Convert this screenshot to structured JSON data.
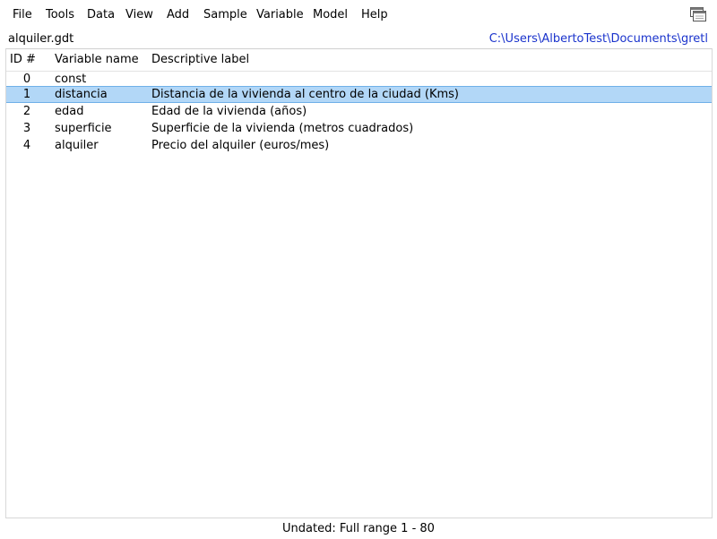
{
  "menu": [
    {
      "label": "File",
      "name": "menu-file"
    },
    {
      "label": "Tools",
      "name": "menu-tools"
    },
    {
      "label": "Data",
      "name": "menu-data"
    },
    {
      "label": "View",
      "name": "menu-view"
    },
    {
      "label": "Add",
      "name": "menu-add"
    },
    {
      "label": "Sample",
      "name": "menu-sample"
    },
    {
      "label": "Variable",
      "name": "menu-variable"
    },
    {
      "label": "Model",
      "name": "menu-model"
    },
    {
      "label": "Help",
      "name": "menu-help"
    }
  ],
  "window_icon": "window-switch-icon",
  "infobar": {
    "filename": "alquiler.gdt",
    "path": "C:\\Users\\AlbertoTest\\Documents\\gretl"
  },
  "table": {
    "headers": {
      "id": "ID #",
      "name": "Variable name",
      "label": "Descriptive label"
    },
    "rows": [
      {
        "id": "0",
        "name": "const",
        "label": "",
        "selected": false
      },
      {
        "id": "1",
        "name": "distancia",
        "label": "Distancia de la vivienda al centro de la ciudad (Kms)",
        "selected": true
      },
      {
        "id": "2",
        "name": "edad",
        "label": "Edad de la vivienda (años)",
        "selected": false
      },
      {
        "id": "3",
        "name": "superficie",
        "label": "Superficie de la vivienda (metros cuadrados)",
        "selected": false
      },
      {
        "id": "4",
        "name": "alquiler",
        "label": "Precio del alquiler (euros/mes)",
        "selected": false
      }
    ]
  },
  "colors": {
    "selection": "#b2d7f7",
    "path_link": "#1a33cc"
  },
  "status": "Undated: Full range 1 - 80"
}
